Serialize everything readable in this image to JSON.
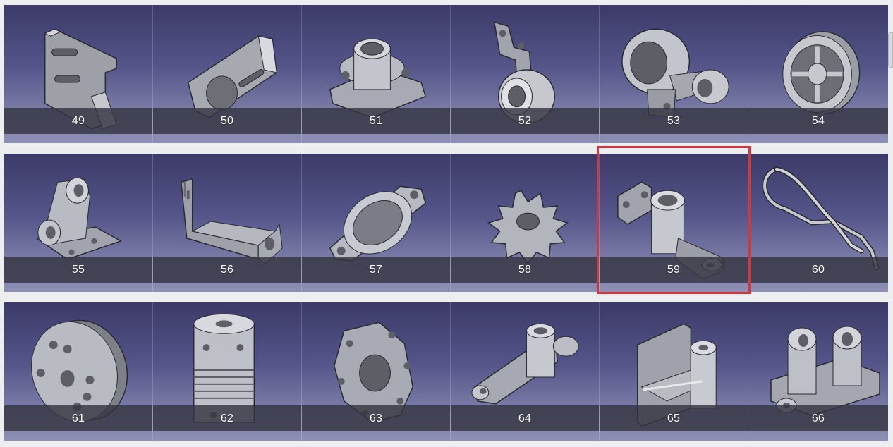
{
  "gallery": {
    "rows": [
      {
        "items": [
          {
            "label": "49",
            "icon": "bracket-slotted-part-icon"
          },
          {
            "label": "50",
            "icon": "clamp-block-part-icon"
          },
          {
            "label": "51",
            "icon": "flange-bearing-part-icon"
          },
          {
            "label": "52",
            "icon": "bent-bracket-bushing-part-icon"
          },
          {
            "label": "53",
            "icon": "lever-arm-part-icon"
          },
          {
            "label": "54",
            "icon": "pulley-wheel-part-icon"
          }
        ]
      },
      {
        "items": [
          {
            "label": "55",
            "icon": "angle-bracket-part-icon"
          },
          {
            "label": "56",
            "icon": "sheet-metal-bracket-part-icon"
          },
          {
            "label": "57",
            "icon": "flange-ring-part-icon"
          },
          {
            "label": "58",
            "icon": "sprocket-gear-part-icon"
          },
          {
            "label": "59",
            "icon": "pillow-block-arm-part-icon"
          },
          {
            "label": "60",
            "icon": "wire-spring-clip-part-icon"
          }
        ]
      },
      {
        "items": [
          {
            "label": "61",
            "icon": "round-plate-part-icon"
          },
          {
            "label": "62",
            "icon": "flexible-coupling-part-icon"
          },
          {
            "label": "63",
            "icon": "slotted-disc-part-icon"
          },
          {
            "label": "64",
            "icon": "rocker-arm-part-icon"
          },
          {
            "label": "65",
            "icon": "mounting-bracket-part-icon"
          },
          {
            "label": "66",
            "icon": "bearing-base-part-icon"
          }
        ]
      }
    ],
    "selected": "59"
  },
  "colors": {
    "selection_border": "#d8343a",
    "tile_bg_top": "#3b3a68",
    "tile_bg_bottom": "#8e8fb4",
    "caption_bar": "#343442",
    "caption_text": "#ffffff"
  }
}
